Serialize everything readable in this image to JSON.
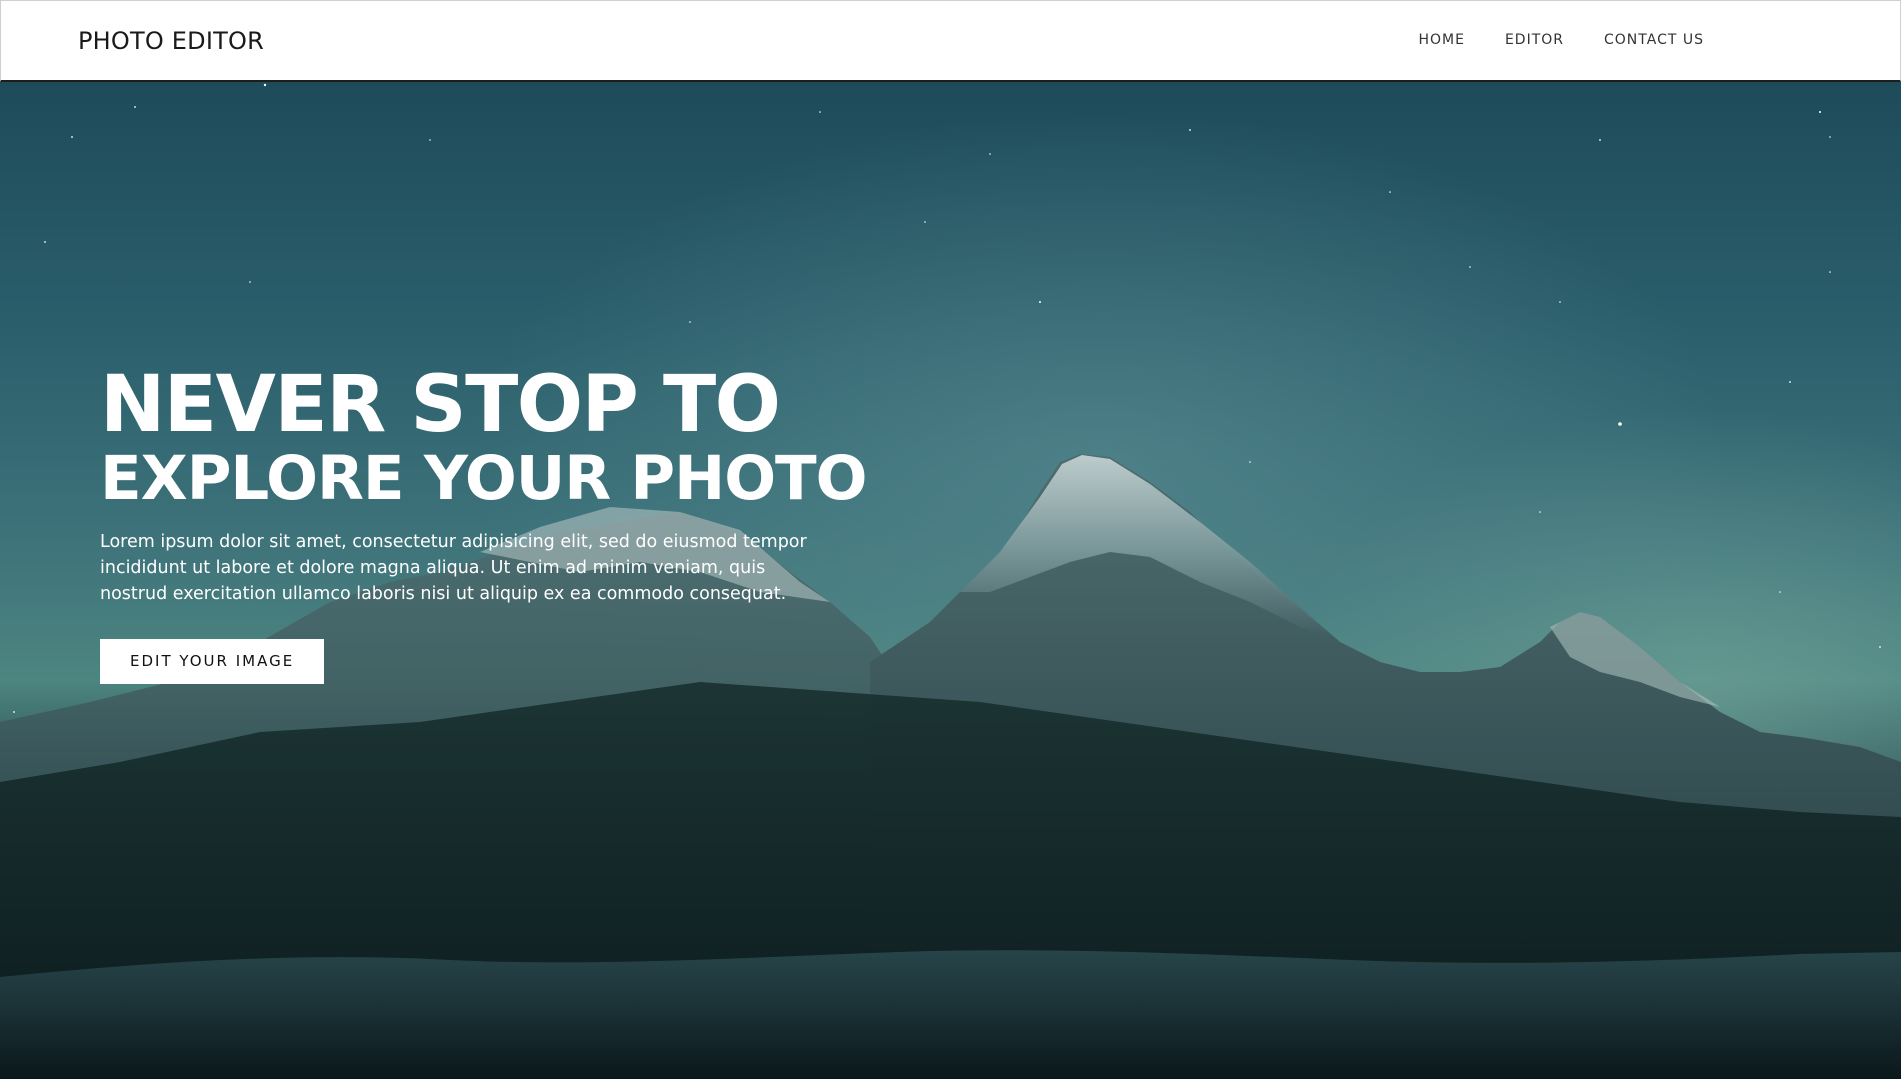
{
  "header": {
    "brand": "PHOTO EDITOR",
    "nav": [
      {
        "label": "HOME"
      },
      {
        "label": "EDITOR"
      },
      {
        "label": "CONTACT US"
      }
    ]
  },
  "hero": {
    "headline_line1": "NEVER STOP TO",
    "headline_line2": "EXPLORE YOUR PHOTO",
    "description": "Lorem ipsum dolor sit amet, consectetur adipisicing elit, sed do eiusmod tempor incididunt ut labore et dolore magna aliqua. Ut enim ad minim veniam, quis nostrud exercitation ullamco laboris nisi ut aliquip ex ea commodo consequat.",
    "cta_label": "EDIT YOUR IMAGE",
    "background_description_icon": "mountain-night-sky-image"
  },
  "colors": {
    "header_bg": "#ffffff",
    "header_border": "#1d1d1d",
    "hero_text": "#ffffff",
    "button_bg": "#ffffff",
    "button_text": "#111111",
    "sky_top": "#1e4b5a",
    "sky_horizon": "#4d8580"
  }
}
